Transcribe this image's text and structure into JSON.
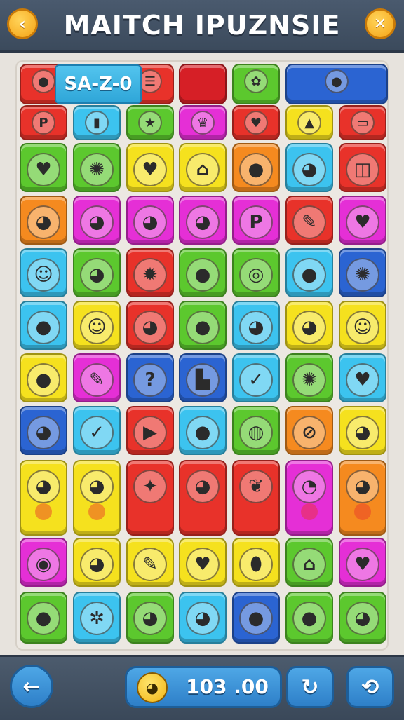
{
  "header": {
    "title": "MAITCH IPUZNSIE",
    "back_icon": "chevron-left-icon",
    "close_icon": "close-icon"
  },
  "banner": {
    "text": "SA-Z-0"
  },
  "tile_colors": {
    "red": "#e8322a",
    "yellow": "#f5e11e",
    "green": "#5cc82e",
    "blue": "#2b64d2",
    "cyan": "#3cc3ef",
    "magenta": "#e52fd6",
    "orange": "#f58a1f",
    "crimson": "#d61f26"
  },
  "rows": [
    [
      {
        "c": "red",
        "i": "lemon"
      },
      {
        "c": "cyan",
        "i": "banner"
      },
      {
        "c": "red",
        "i": "menu"
      },
      {
        "c": "crimson",
        "i": ""
      },
      {
        "c": "green",
        "i": "flower"
      },
      {
        "c": "blue",
        "i": "balloon"
      },
      {
        "c": "blue",
        "i": "ghost"
      }
    ],
    [
      {
        "c": "red",
        "i": "letter-p"
      },
      {
        "c": "cyan",
        "i": "bottle"
      },
      {
        "c": "green",
        "i": "star"
      },
      {
        "c": "magenta",
        "i": "crown"
      },
      {
        "c": "red",
        "i": "heart"
      },
      {
        "c": "yellow",
        "i": "arrow-up"
      },
      {
        "c": "red",
        "i": "card"
      }
    ],
    [
      {
        "c": "green",
        "i": "leaf-heart"
      },
      {
        "c": "green",
        "i": "splat"
      },
      {
        "c": "yellow",
        "i": "heart"
      },
      {
        "c": "yellow",
        "i": "house"
      },
      {
        "c": "orange",
        "i": "tomato"
      },
      {
        "c": "cyan",
        "i": "blob"
      },
      {
        "c": "red",
        "i": "envelope"
      }
    ],
    [
      {
        "c": "orange",
        "i": "bunny"
      },
      {
        "c": "magenta",
        "i": "cat"
      },
      {
        "c": "magenta",
        "i": "chick"
      },
      {
        "c": "magenta",
        "i": "cat"
      },
      {
        "c": "magenta",
        "i": "letter-p"
      },
      {
        "c": "red",
        "i": "pencil"
      },
      {
        "c": "magenta",
        "i": "heart-badge"
      }
    ],
    [
      {
        "c": "cyan",
        "i": "smile"
      },
      {
        "c": "green",
        "i": "cat"
      },
      {
        "c": "red",
        "i": "gear"
      },
      {
        "c": "green",
        "i": "apple"
      },
      {
        "c": "green",
        "i": "donut"
      },
      {
        "c": "cyan",
        "i": "lemon"
      },
      {
        "c": "blue",
        "i": "splat"
      }
    ],
    [
      {
        "c": "cyan",
        "i": "apple"
      },
      {
        "c": "yellow",
        "i": "smile"
      },
      {
        "c": "red",
        "i": "cat"
      },
      {
        "c": "green",
        "i": "apple"
      },
      {
        "c": "cyan",
        "i": "bear"
      },
      {
        "c": "yellow",
        "i": "fox"
      },
      {
        "c": "yellow",
        "i": "smile"
      }
    ],
    [
      {
        "c": "yellow",
        "i": "balloon"
      },
      {
        "c": "magenta",
        "i": "pencil"
      },
      {
        "c": "blue",
        "i": "question"
      },
      {
        "c": "blue",
        "i": "hammer"
      },
      {
        "c": "cyan",
        "i": "check-circle"
      },
      {
        "c": "green",
        "i": "splat"
      },
      {
        "c": "cyan",
        "i": "heart"
      }
    ],
    [
      {
        "c": "blue",
        "i": "cat"
      },
      {
        "c": "cyan",
        "i": "check-heart"
      },
      {
        "c": "red",
        "i": "play"
      },
      {
        "c": "cyan",
        "i": "balloon"
      },
      {
        "c": "green",
        "i": "globe"
      },
      {
        "c": "orange",
        "i": "compass"
      },
      {
        "c": "yellow",
        "i": "bear"
      }
    ],
    [
      {
        "c": "yellow",
        "i": "fox"
      },
      {
        "c": "yellow",
        "i": "cat"
      },
      {
        "c": "red",
        "i": "bat"
      },
      {
        "c": "red",
        "i": "bear"
      },
      {
        "c": "red",
        "i": "leaf"
      },
      {
        "c": "magenta",
        "i": "ghost"
      },
      {
        "c": "orange",
        "i": "chick"
      }
    ],
    [
      {
        "c": "magenta",
        "i": "leaf-circle"
      },
      {
        "c": "yellow",
        "i": "cat"
      },
      {
        "c": "yellow",
        "i": "pencil"
      },
      {
        "c": "yellow",
        "i": "heart"
      },
      {
        "c": "yellow",
        "i": "bean"
      },
      {
        "c": "green",
        "i": "house"
      },
      {
        "c": "magenta",
        "i": "heart"
      }
    ],
    [
      {
        "c": "green",
        "i": "orange"
      },
      {
        "c": "cyan",
        "i": "ladybug"
      },
      {
        "c": "green",
        "i": "bear"
      },
      {
        "c": "cyan",
        "i": "chick"
      },
      {
        "c": "blue",
        "i": "lemon"
      },
      {
        "c": "green",
        "i": "apple"
      },
      {
        "c": "green",
        "i": "blob"
      }
    ]
  ],
  "footer": {
    "back_icon": "arrow-left-icon",
    "score_icon": "chick-icon",
    "score_value": "103 .00",
    "refresh_icon": "refresh-icon",
    "hint_icon": "search-icon"
  }
}
